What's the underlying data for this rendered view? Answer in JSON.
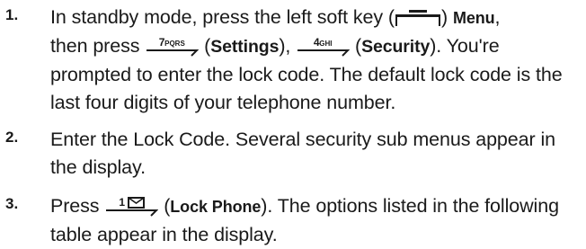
{
  "steps": [
    {
      "number": "1.",
      "text_a": "In standby mode, press the left soft key (",
      "softkey_icon": "left-soft-key-icon",
      "text_b": ")",
      "menu_label": "Menu",
      "text_c": ",",
      "text_d": "then press",
      "key1_digit": "7",
      "key1_letters": "PQRS",
      "text_e": "(",
      "settings_label": "Settings",
      "text_f": "),",
      "key2_digit": "4",
      "key2_letters": "GHI",
      "text_g": "(",
      "security_label": "Security",
      "text_h": "). You're prompted to enter the lock code. The default lock code is the last four digits of your telephone number."
    },
    {
      "number": "2.",
      "text": "Enter the Lock Code. Several security sub menus appear in the display."
    },
    {
      "number": "3.",
      "text_a": "Press",
      "key_digit": "1",
      "key_icon": "envelope-icon",
      "text_b": "(",
      "lock_phone_label": "Lock Phone",
      "text_c": "). The options listed in the following table appear in the display."
    }
  ]
}
